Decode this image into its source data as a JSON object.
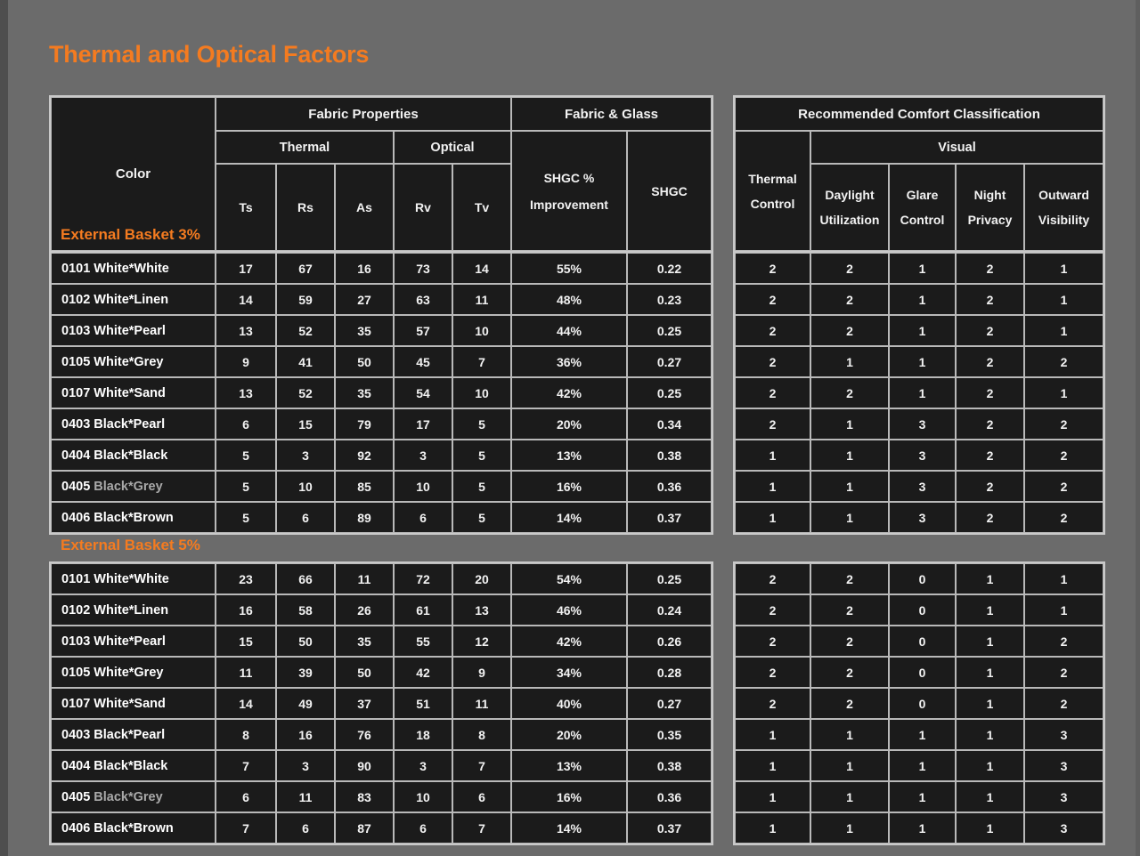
{
  "page": {
    "title": "Thermal and Optical Factors",
    "accent_color": "#f47b20",
    "background_color": "#6b6b6b",
    "cell_color": "#1b1b1b",
    "grid_color": "#b9b9b9"
  },
  "left_table": {
    "header": {
      "color": "Color",
      "fabric_properties": "Fabric Properties",
      "fabric_glass": "Fabric & Glass",
      "thermal": "Thermal",
      "optical": "Optical",
      "ts": "Ts",
      "rs": "Rs",
      "as": "As",
      "rv": "Rv",
      "tv": "Tv",
      "shgc_improvement_l1": "SHGC %",
      "shgc_improvement_l2": "Improvement",
      "shgc": "SHGC"
    }
  },
  "right_table": {
    "header": {
      "title": "Recommended Comfort Classification",
      "thermal_control_l1": "Thermal",
      "thermal_control_l2": "Control",
      "visual": "Visual",
      "daylight_l1": "Daylight",
      "daylight_l2": "Utilization",
      "glare_l1": "Glare",
      "glare_l2": "Control",
      "night_l1": "Night",
      "night_l2": "Privacy",
      "outward_l1": "Outward",
      "outward_l2": "Visibility"
    }
  },
  "sections": [
    {
      "label": "External Basket 3%",
      "rows": [
        {
          "code": "0101",
          "name": "White*White",
          "dim_name": false,
          "Ts": "17",
          "Rs": "67",
          "As": "16",
          "Rv": "73",
          "Tv": "14",
          "shgc_improvement": "55%",
          "shgc": "0.22",
          "thermal_control": "2",
          "daylight_utilization": "2",
          "glare_control": "1",
          "night_privacy": "2",
          "outward_visibility": "1"
        },
        {
          "code": "0102",
          "name": "White*Linen",
          "dim_name": false,
          "Ts": "14",
          "Rs": "59",
          "As": "27",
          "Rv": "63",
          "Tv": "11",
          "shgc_improvement": "48%",
          "shgc": "0.23",
          "thermal_control": "2",
          "daylight_utilization": "2",
          "glare_control": "1",
          "night_privacy": "2",
          "outward_visibility": "1"
        },
        {
          "code": "0103",
          "name": "White*Pearl",
          "dim_name": false,
          "Ts": "13",
          "Rs": "52",
          "As": "35",
          "Rv": "57",
          "Tv": "10",
          "shgc_improvement": "44%",
          "shgc": "0.25",
          "thermal_control": "2",
          "daylight_utilization": "2",
          "glare_control": "1",
          "night_privacy": "2",
          "outward_visibility": "1"
        },
        {
          "code": "0105",
          "name": "White*Grey",
          "dim_name": false,
          "Ts": "9",
          "Rs": "41",
          "As": "50",
          "Rv": "45",
          "Tv": "7",
          "shgc_improvement": "36%",
          "shgc": "0.27",
          "thermal_control": "2",
          "daylight_utilization": "1",
          "glare_control": "1",
          "night_privacy": "2",
          "outward_visibility": "2"
        },
        {
          "code": "0107",
          "name": "White*Sand",
          "dim_name": false,
          "Ts": "13",
          "Rs": "52",
          "As": "35",
          "Rv": "54",
          "Tv": "10",
          "shgc_improvement": "42%",
          "shgc": "0.25",
          "thermal_control": "2",
          "daylight_utilization": "2",
          "glare_control": "1",
          "night_privacy": "2",
          "outward_visibility": "1"
        },
        {
          "code": "0403",
          "name": "Black*Pearl",
          "dim_name": false,
          "Ts": "6",
          "Rs": "15",
          "As": "79",
          "Rv": "17",
          "Tv": "5",
          "shgc_improvement": "20%",
          "shgc": "0.34",
          "thermal_control": "2",
          "daylight_utilization": "1",
          "glare_control": "3",
          "night_privacy": "2",
          "outward_visibility": "2"
        },
        {
          "code": "0404",
          "name": "Black*Black",
          "dim_name": false,
          "Ts": "5",
          "Rs": "3",
          "As": "92",
          "Rv": "3",
          "Tv": "5",
          "shgc_improvement": "13%",
          "shgc": "0.38",
          "thermal_control": "1",
          "daylight_utilization": "1",
          "glare_control": "3",
          "night_privacy": "2",
          "outward_visibility": "2"
        },
        {
          "code": "0405",
          "name": "Black*Grey",
          "dim_name": true,
          "Ts": "5",
          "Rs": "10",
          "As": "85",
          "Rv": "10",
          "Tv": "5",
          "shgc_improvement": "16%",
          "shgc": "0.36",
          "thermal_control": "1",
          "daylight_utilization": "1",
          "glare_control": "3",
          "night_privacy": "2",
          "outward_visibility": "2"
        },
        {
          "code": "0406",
          "name": "Black*Brown",
          "dim_name": false,
          "Ts": "5",
          "Rs": "6",
          "As": "89",
          "Rv": "6",
          "Tv": "5",
          "shgc_improvement": "14%",
          "shgc": "0.37",
          "thermal_control": "1",
          "daylight_utilization": "1",
          "glare_control": "3",
          "night_privacy": "2",
          "outward_visibility": "2"
        }
      ]
    },
    {
      "label": "External Basket 5%",
      "rows": [
        {
          "code": "0101",
          "name": "White*White",
          "dim_name": false,
          "Ts": "23",
          "Rs": "66",
          "As": "11",
          "Rv": "72",
          "Tv": "20",
          "shgc_improvement": "54%",
          "shgc": "0.25",
          "thermal_control": "2",
          "daylight_utilization": "2",
          "glare_control": "0",
          "night_privacy": "1",
          "outward_visibility": "1"
        },
        {
          "code": "0102",
          "name": "White*Linen",
          "dim_name": false,
          "Ts": "16",
          "Rs": "58",
          "As": "26",
          "Rv": "61",
          "Tv": "13",
          "shgc_improvement": "46%",
          "shgc": "0.24",
          "thermal_control": "2",
          "daylight_utilization": "2",
          "glare_control": "0",
          "night_privacy": "1",
          "outward_visibility": "1"
        },
        {
          "code": "0103",
          "name": "White*Pearl",
          "dim_name": false,
          "Ts": "15",
          "Rs": "50",
          "As": "35",
          "Rv": "55",
          "Tv": "12",
          "shgc_improvement": "42%",
          "shgc": "0.26",
          "thermal_control": "2",
          "daylight_utilization": "2",
          "glare_control": "0",
          "night_privacy": "1",
          "outward_visibility": "2"
        },
        {
          "code": "0105",
          "name": "White*Grey",
          "dim_name": false,
          "Ts": "11",
          "Rs": "39",
          "As": "50",
          "Rv": "42",
          "Tv": "9",
          "shgc_improvement": "34%",
          "shgc": "0.28",
          "thermal_control": "2",
          "daylight_utilization": "2",
          "glare_control": "0",
          "night_privacy": "1",
          "outward_visibility": "2"
        },
        {
          "code": "0107",
          "name": "White*Sand",
          "dim_name": false,
          "Ts": "14",
          "Rs": "49",
          "As": "37",
          "Rv": "51",
          "Tv": "11",
          "shgc_improvement": "40%",
          "shgc": "0.27",
          "thermal_control": "2",
          "daylight_utilization": "2",
          "glare_control": "0",
          "night_privacy": "1",
          "outward_visibility": "2"
        },
        {
          "code": "0403",
          "name": "Black*Pearl",
          "dim_name": false,
          "Ts": "8",
          "Rs": "16",
          "As": "76",
          "Rv": "18",
          "Tv": "8",
          "shgc_improvement": "20%",
          "shgc": "0.35",
          "thermal_control": "1",
          "daylight_utilization": "1",
          "glare_control": "1",
          "night_privacy": "1",
          "outward_visibility": "3"
        },
        {
          "code": "0404",
          "name": "Black*Black",
          "dim_name": false,
          "Ts": "7",
          "Rs": "3",
          "As": "90",
          "Rv": "3",
          "Tv": "7",
          "shgc_improvement": "13%",
          "shgc": "0.38",
          "thermal_control": "1",
          "daylight_utilization": "1",
          "glare_control": "1",
          "night_privacy": "1",
          "outward_visibility": "3"
        },
        {
          "code": "0405",
          "name": "Black*Grey",
          "dim_name": true,
          "Ts": "6",
          "Rs": "11",
          "As": "83",
          "Rv": "10",
          "Tv": "6",
          "shgc_improvement": "16%",
          "shgc": "0.36",
          "thermal_control": "1",
          "daylight_utilization": "1",
          "glare_control": "1",
          "night_privacy": "1",
          "outward_visibility": "3"
        },
        {
          "code": "0406",
          "name": "Black*Brown",
          "dim_name": false,
          "Ts": "7",
          "Rs": "6",
          "As": "87",
          "Rv": "6",
          "Tv": "7",
          "shgc_improvement": "14%",
          "shgc": "0.37",
          "thermal_control": "1",
          "daylight_utilization": "1",
          "glare_control": "1",
          "night_privacy": "1",
          "outward_visibility": "3"
        }
      ]
    }
  ]
}
